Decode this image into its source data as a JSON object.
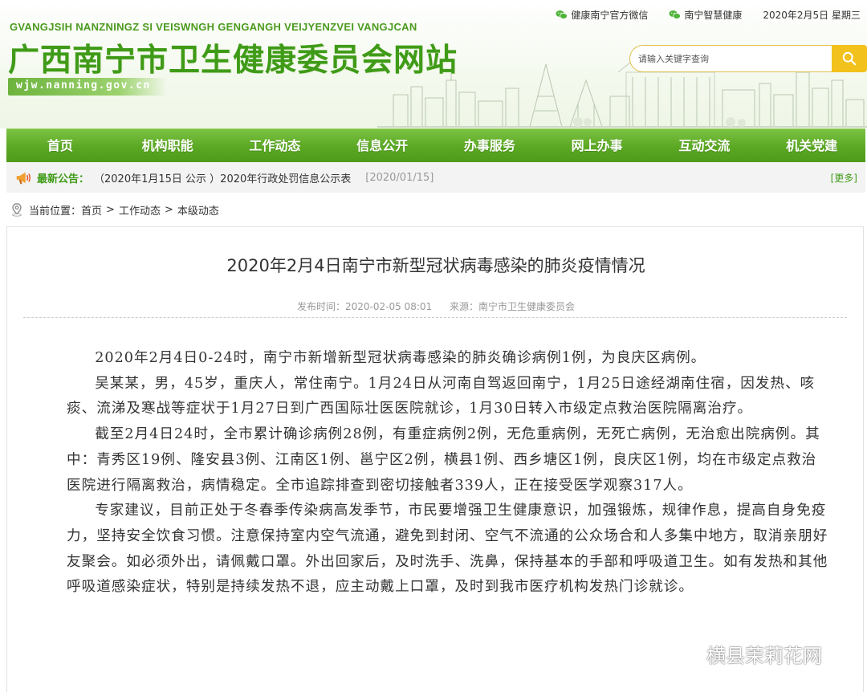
{
  "header": {
    "pinyin": "GVANGJSIH NANZNINGZ SI VEISWNGH GENGANGH VEIJYENZVEI VANGJCAN",
    "title": "广西南宁市卫生健康委员会网站",
    "domain": "wjw.nanning.gov.cn",
    "links": [
      "健康南宁官方微信",
      "南宁智慧健康"
    ],
    "date": "2020年2月5日 星期三"
  },
  "search": {
    "value": "请输入关键字查询"
  },
  "nav": [
    "首页",
    "机构职能",
    "工作动态",
    "信息公开",
    "办事服务",
    "网上办事",
    "互动交流",
    "机关党建"
  ],
  "notice": {
    "label": "最新公告：",
    "text": "（2020年1月15日 公示 ）2020年行政处罚信息公示表",
    "date": "[2020/01/15]",
    "more": "[更多]"
  },
  "breadcrumb": {
    "label": "当前位置：",
    "items": [
      "首页",
      "工作动态",
      "本级动态"
    ],
    "separator": ">"
  },
  "article": {
    "title": "2020年2月4日南宁市新型冠状病毒感染的肺炎疫情情况",
    "publish_time": "发布时间：2020-02-05 08:01",
    "source": "来源：南宁市卫生健康委员会",
    "paragraphs": [
      "2020年2月4日0-24时，南宁市新增新型冠状病毒感染的肺炎确诊病例1例，为良庆区病例。",
      "吴某某，男，45岁，重庆人，常住南宁。1月24日从河南自驾返回南宁，1月25日途经湖南住宿，因发热、咳痰、流涕及寒战等症状于1月27日到广西国际壮医医院就诊，1月30日转入市级定点救治医院隔离治疗。",
      "截至2月4日24时，全市累计确诊病例28例，有重症病例2例，无危重病例，无死亡病例，无治愈出院病例。其中：青秀区19例、隆安县3例、江南区1例、邕宁区2例，横县1例、西乡塘区1例，良庆区1例，均在市级定点救治医院进行隔离救治，病情稳定。全市追踪排查到密切接触者339人，正在接受医学观察317人。",
      "专家建议，目前正处于冬春季传染病高发季节，市民要增强卫生健康意识，加强锻炼，规律作息，提高自身免疫力，坚持安全饮食习惯。注意保持室内空气流通，避免到封闭、空气不流通的公众场合和人多集中地方，取消亲朋好友聚会。如必须外出，请佩戴口罩。外出回家后，及时洗手、洗鼻，保持基本的手部和呼吸道卫生。如有发热和其他呼吸道感染症状，特别是持续发热不退，应主动戴上口罩，及时到我市医疗机构发热门诊就诊。"
    ]
  },
  "watermark": "横县茉莉花网",
  "colors": {
    "brand_green": "#3f9b17",
    "nav_green": "#5aa823",
    "search_yellow": "#f2c11c"
  }
}
